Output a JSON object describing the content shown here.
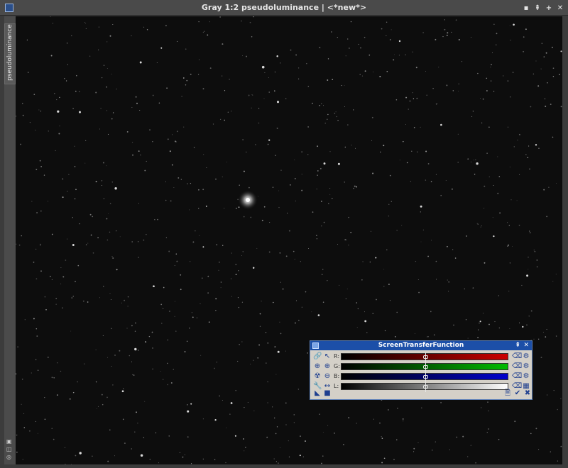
{
  "window": {
    "title": "Gray 1:2 pseudoluminance | <*new*>"
  },
  "window_controls": [
    "▪",
    "⇞",
    "+",
    "✕"
  ],
  "side_tab": {
    "label": "pseudoluminance"
  },
  "stf": {
    "title": "ScreenTransferFunction",
    "title_controls": [
      "⇞",
      "✕"
    ],
    "channels": [
      {
        "label": "R:",
        "color": "#cc0000"
      },
      {
        "label": "G:",
        "color": "#00bb00"
      },
      {
        "label": "B:",
        "color": "#0000cc"
      },
      {
        "label": "L:",
        "color": "#ffffff"
      }
    ],
    "left_icons": [
      [
        "link-icon",
        "pointer-icon"
      ],
      [
        "zoom-in-icon",
        "zoom-in-alt-icon"
      ],
      [
        "auto-stretch-icon",
        "zoom-out-icon"
      ],
      [
        "edit-icon",
        "horizontal-icon"
      ]
    ],
    "right_icons": [
      [
        "reset-r-icon",
        "settings-r-icon"
      ],
      [
        "reset-g-icon",
        "settings-g-icon"
      ],
      [
        "reset-b-icon",
        "settings-b-icon"
      ],
      [
        "reset-l-icon",
        "image-l-icon"
      ]
    ]
  },
  "viewer": {
    "background": "#0d0d0d"
  }
}
